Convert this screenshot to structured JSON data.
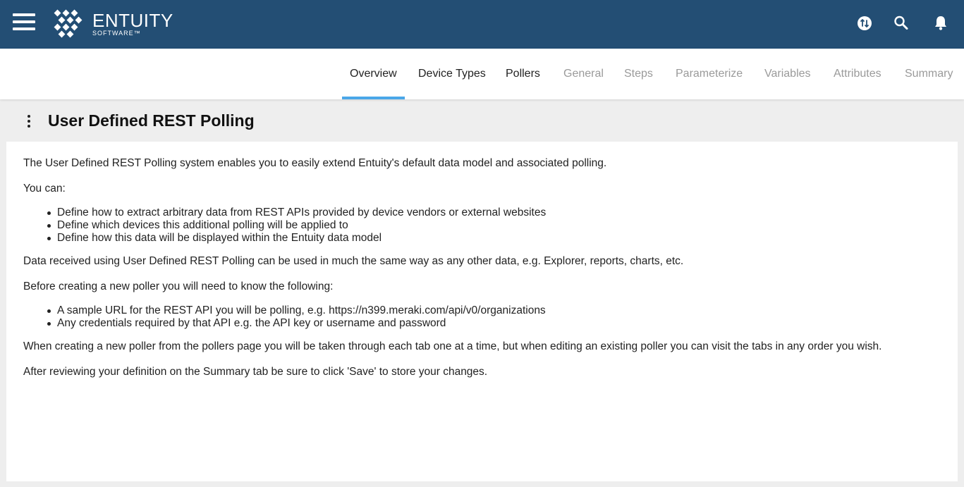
{
  "brand": {
    "name": "ENTUITY",
    "subtitle": "SOFTWARE™"
  },
  "topbar_icons": [
    "switch-icon",
    "search-icon",
    "bell-icon"
  ],
  "tabs": [
    {
      "label": "Overview",
      "state": "active"
    },
    {
      "label": "Device Types",
      "state": "enabled"
    },
    {
      "label": "Pollers",
      "state": "enabled"
    },
    {
      "label": "General",
      "state": "disabled"
    },
    {
      "label": "Steps",
      "state": "disabled"
    },
    {
      "label": "Parameterize",
      "state": "disabled"
    },
    {
      "label": "Variables",
      "state": "disabled"
    },
    {
      "label": "Attributes",
      "state": "disabled"
    },
    {
      "label": "Summary",
      "state": "disabled"
    }
  ],
  "page": {
    "title": "User Defined REST Polling"
  },
  "overview": {
    "intro": "The User Defined REST Polling system enables you to easily extend Entuity's default data model and associated polling.",
    "you_can": "You can:",
    "capabilities": [
      "Define how to extract arbitrary data from REST APIs provided by device vendors or external websites",
      "Define which devices this additional polling will be applied to",
      "Define how this data will be displayed within the Entuity data model"
    ],
    "usage": "Data received using User Defined REST Polling can be used in much the same way as any other data, e.g. Explorer, reports, charts, etc.",
    "before": "Before creating a new poller you will need to know the following:",
    "requirements": [
      "A sample URL for the REST API you will be polling, e.g. https://n399.meraki.com/api/v0/organizations",
      "Any credentials required by that API e.g. the API key or username and password"
    ],
    "workflow": "When creating a new poller from the pollers page you will be taken through each tab one at a time, but when editing an existing poller you can visit the tabs in any order you wish.",
    "save_note": "After reviewing your definition on the Summary tab be sure to click 'Save' to store your changes."
  },
  "colors": {
    "topbar": "#234e74",
    "tab_active_underline": "#4aa7e8",
    "tab_disabled": "#9a9a9a",
    "background": "#eeeeee"
  }
}
